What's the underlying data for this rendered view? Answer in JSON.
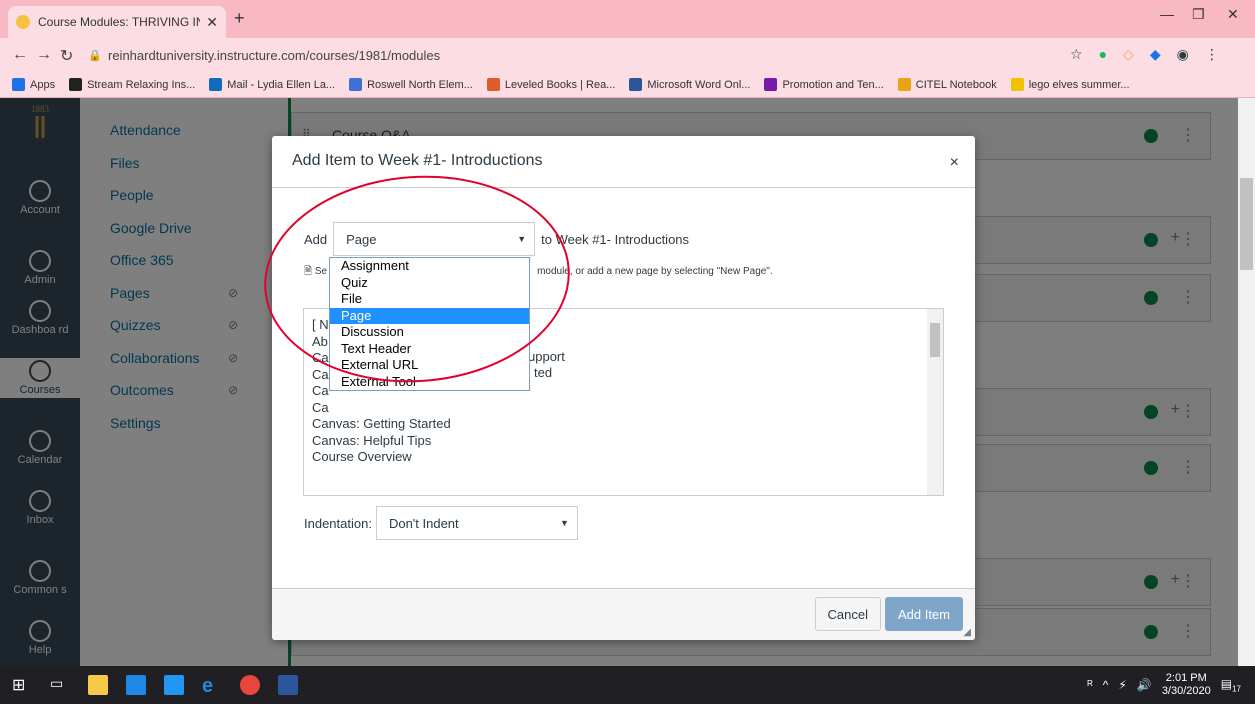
{
  "browser": {
    "tab_title": "Course Modules: THRIVING IN C",
    "url": "reinhardtuniversity.instructure.com/courses/1981/modules",
    "bookmarks": [
      {
        "label": "Apps",
        "color": "#1a73e8"
      },
      {
        "label": "Stream Relaxing Ins...",
        "color": "#222222"
      },
      {
        "label": "Mail - Lydia Ellen La...",
        "color": "#0f6cbd"
      },
      {
        "label": "Roswell North Elem...",
        "color": "#3f6fd8"
      },
      {
        "label": "Leveled Books | Rea...",
        "color": "#e05a2a"
      },
      {
        "label": "Microsoft Word Onl...",
        "color": "#2b579a"
      },
      {
        "label": "Promotion and Ten...",
        "color": "#7719aa"
      },
      {
        "label": "CITEL Notebook",
        "color": "#e8a317"
      },
      {
        "label": "lego elves summer...",
        "color": "#f2c200"
      }
    ]
  },
  "global_nav": {
    "logo_year": "1883",
    "items": [
      {
        "label": "Account"
      },
      {
        "label": "Admin"
      },
      {
        "label": "Dashboa rd"
      },
      {
        "label": "Courses"
      },
      {
        "label": "Calendar"
      },
      {
        "label": "Inbox"
      },
      {
        "label": "Common s"
      },
      {
        "label": "Help"
      }
    ]
  },
  "course_nav": {
    "items": [
      "Attendance",
      "Files",
      "People",
      "Google Drive",
      "Office 365",
      "Pages",
      "Quizzes",
      "Collaborations",
      "Outcomes",
      "Settings"
    ]
  },
  "modules": {
    "first_title": "Course Q&A"
  },
  "modal": {
    "title": "Add Item to Week #1- Introductions",
    "close_symbol": "×",
    "add_label": "Add",
    "type_value": "Page",
    "to_label": "to Week #1- Introductions",
    "hint_left": "Se",
    "hint_right": "module, or add a new page by selecting \"New Page\".",
    "list_items": [
      "[ N",
      "Ab",
      "Ca",
      "Ca",
      "Ca",
      "Ca",
      "Canvas: Getting Started",
      "Canvas: Helpful Tips",
      "Course Overview"
    ],
    "list_item_fragments": {
      "support": "upport",
      "started": "ted"
    },
    "indent_label": "Indentation:",
    "indent_value": "Don't Indent",
    "cancel_label": "Cancel",
    "add_item_label": "Add Item",
    "type_options": [
      "Assignment",
      "Quiz",
      "File",
      "Page",
      "Discussion",
      "Text Header",
      "External URL",
      "External Tool"
    ],
    "selected_option": "Page"
  },
  "taskbar": {
    "time": "2:01 PM",
    "date": "3/30/2020",
    "notifications": "17"
  }
}
